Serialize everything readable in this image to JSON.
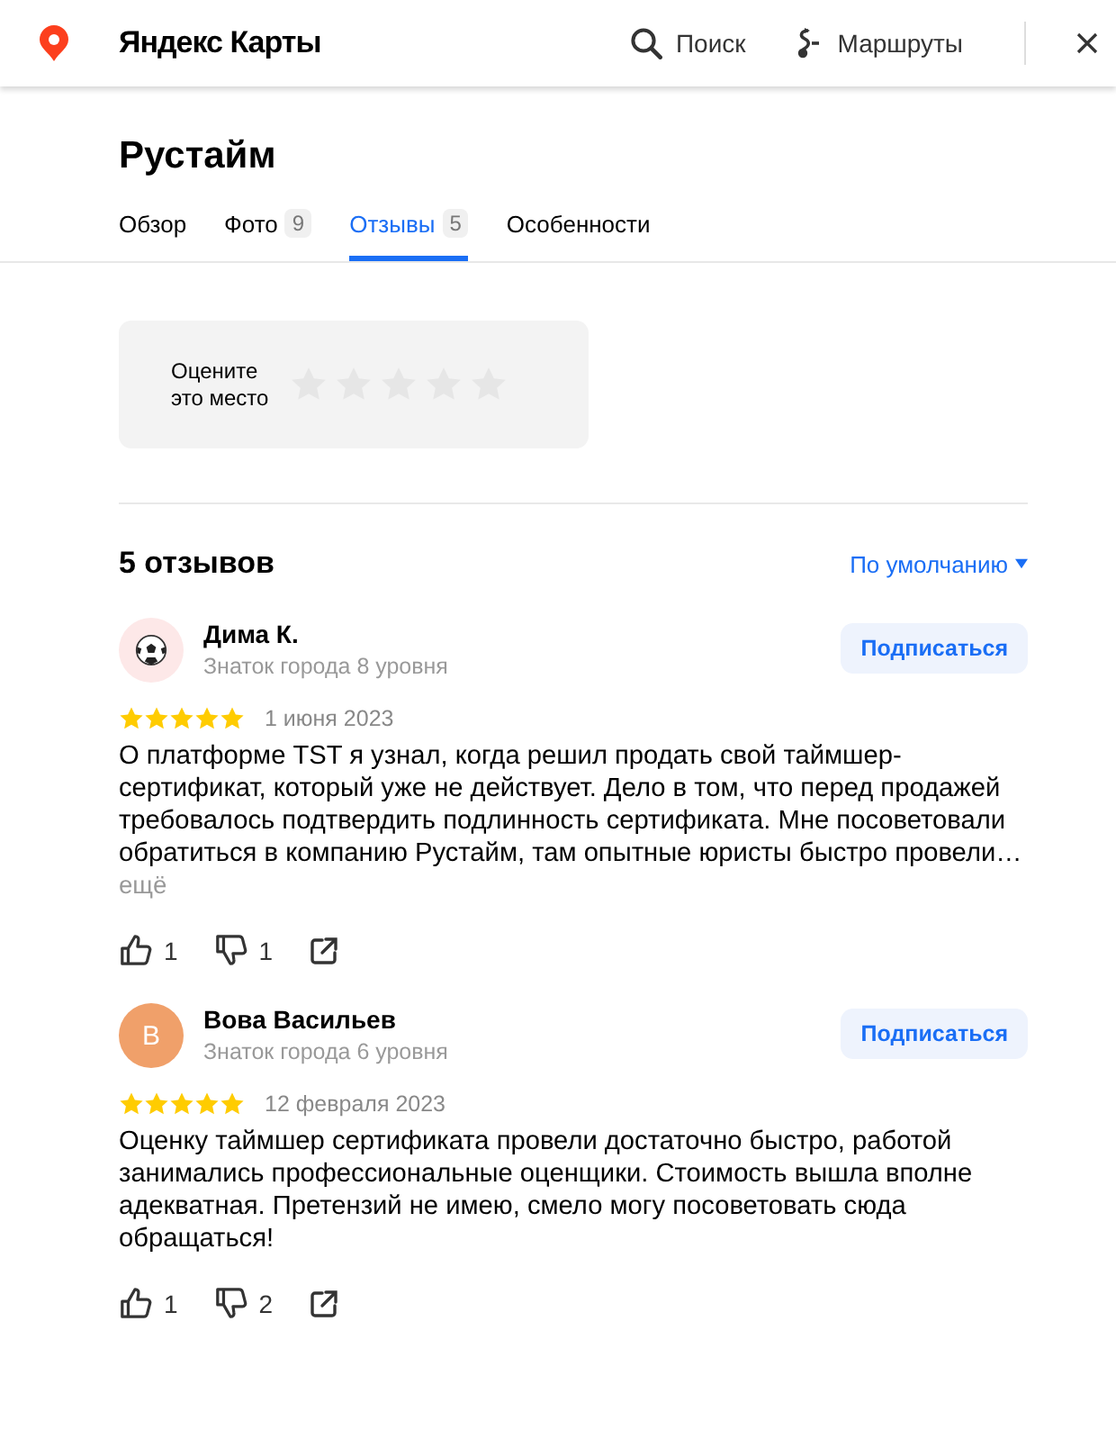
{
  "header": {
    "logo": "Яндекс Карты",
    "nav": [
      {
        "kind": "search",
        "label": "Поиск"
      },
      {
        "kind": "routes",
        "label": "Маршруты"
      }
    ]
  },
  "place": {
    "title": "Рустайм"
  },
  "tabs": [
    {
      "label": "Обзор",
      "selected": false
    },
    {
      "label": "Фото",
      "count": "9",
      "selected": false
    },
    {
      "label": "Отзывы",
      "count": "5",
      "selected": true
    },
    {
      "label": "Особенности",
      "selected": false
    }
  ],
  "rate": {
    "label": "Оцените это место"
  },
  "reviews_header": {
    "title": "5 отзывов",
    "sort": "По умолчанию"
  },
  "reviews": [
    {
      "avatar": {
        "kind": "ball"
      },
      "name": "Дима К.",
      "level": "Знаток города 8 уровня",
      "subscribe": "Подписаться",
      "stars": 5,
      "date": "1 июня 2023",
      "text": "О платформе TST я узнал, когда решил продать свой таймшер-сертификат, который уже не действует. Дело в том, что перед продажей требовалось подтвердить подлинность сертификата. Мне посоветовали обратиться в компанию Рустайм, там опытные юристы быстро провели…",
      "more": "ещё",
      "likes": "1",
      "dislikes": "1"
    },
    {
      "avatar": {
        "kind": "letter",
        "letter": "В",
        "color": "#f0a06a"
      },
      "name": "Вова Васильев",
      "level": "Знаток города 6 уровня",
      "subscribe": "Подписаться",
      "stars": 5,
      "date": "12 февраля 2023",
      "text": "Оценку таймшер сертификата провели достаточно быстро, работой занимались профессиональные оценщики. Стоимость вышла вполне адекватная. Претензий не имею, смело могу посоветовать сюда обращаться!",
      "likes": "1",
      "dislikes": "2"
    }
  ]
}
